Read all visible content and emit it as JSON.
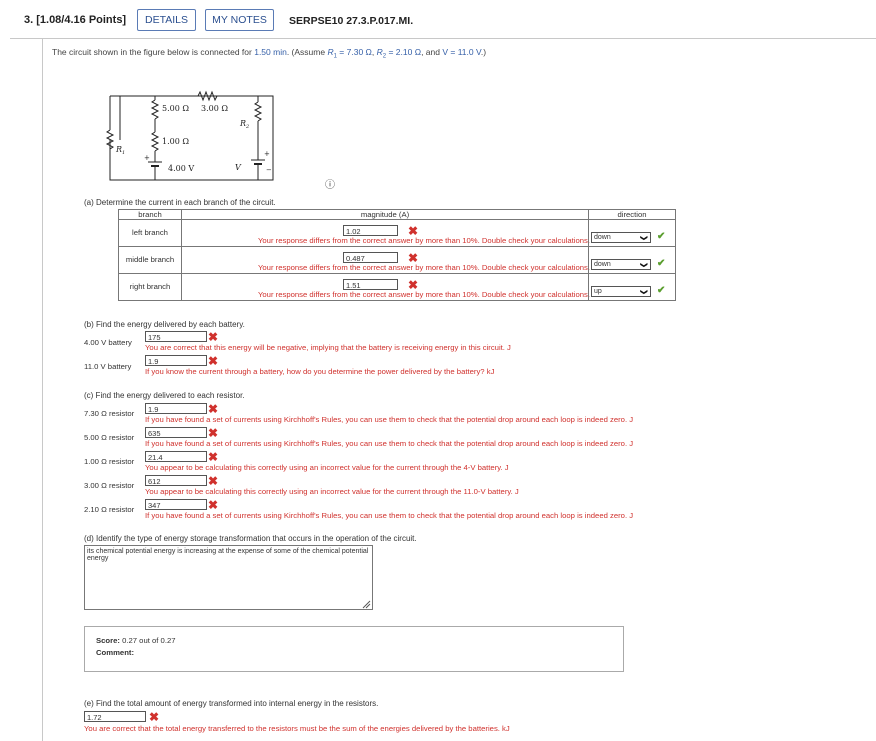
{
  "header": {
    "question_number": "3.  [1.08/4.16 Points]",
    "details_label": "DETAILS",
    "my_notes_label": "MY NOTES",
    "problem_id": "SERPSE10 27.3.P.017.MI."
  },
  "prompt": {
    "text_a": "The circuit shown in the figure below is connected for ",
    "time": "1.50 min",
    "text_b": ". (Assume ",
    "r1_sym": "R",
    "r1_sub": "1",
    "r1_val": " = 7.30 Ω",
    "sep1": ", ",
    "r2_sym": "R",
    "r2_sub": "2",
    "r2_val": " = 2.10 Ω",
    "sep2": ", and ",
    "v_val": "V = 11.0 V",
    "text_c": ".)"
  },
  "figure": {
    "label_5ohm": "5.00 Ω",
    "label_3ohm": "3.00 Ω",
    "label_1ohm": "1.00 Ω",
    "label_4v": "4.00 V",
    "label_r1": "R",
    "label_r1_sub": "1",
    "label_r2": "R",
    "label_r2_sub": "2",
    "label_v": "V",
    "plus1": "+",
    "plus2": "+",
    "minus2": "−"
  },
  "part_a": {
    "question": "(a) Determine the current in each branch of the circuit.",
    "col_branch": "branch",
    "col_magnitude": "magnitude (A)",
    "col_direction": "direction",
    "rows": [
      {
        "branch": "left branch",
        "value": "1.02",
        "feedback": "Your response differs from the correct answer by more than 10%. Double check your calculations.",
        "direction": "down"
      },
      {
        "branch": "middle branch",
        "value": "0.487",
        "feedback": "Your response differs from the correct answer by more than 10%. Double check your calculations.",
        "direction": "down"
      },
      {
        "branch": "right branch",
        "value": "1.51",
        "feedback": "Your response differs from the correct answer by more than 10%. Double check your calculations.",
        "direction": "up"
      }
    ]
  },
  "part_b": {
    "question": "(b) Find the energy delivered by each battery.",
    "rows": [
      {
        "label": "4.00 V battery",
        "value": "175",
        "feedback": "You are correct that this energy will be negative, implying that the battery is receiving energy in this circuit. J"
      },
      {
        "label": "11.0 V battery",
        "value": "1.9",
        "feedback": "If you know the current through a battery, how do you determine the power delivered by the battery? kJ"
      }
    ]
  },
  "part_c": {
    "question": "(c) Find the energy delivered to each resistor.",
    "rows": [
      {
        "label": "7.30 Ω resistor",
        "value": "1.9",
        "feedback": "If you have found a set of currents using Kirchhoff's Rules, you can use them to check that the potential drop around each loop is indeed zero. J"
      },
      {
        "label": "5.00 Ω resistor",
        "value": "635",
        "feedback": "If you have found a set of currents using Kirchhoff's Rules, you can use them to check that the potential drop around each loop is indeed zero. J"
      },
      {
        "label": "1.00 Ω resistor",
        "value": "21.4",
        "feedback": "You appear to be calculating this correctly using an incorrect value for the current through the 4-V battery. J"
      },
      {
        "label": "3.00 Ω resistor",
        "value": "612",
        "feedback": "You appear to be calculating this correctly using an incorrect value for the current through the 11.0-V battery. J"
      },
      {
        "label": "2.10 Ω resistor",
        "value": "347",
        "feedback": "If you have found a set of currents using Kirchhoff's Rules, you can use them to check that the potential drop around each loop is indeed zero. J"
      }
    ]
  },
  "part_d": {
    "question": "(d) Identify the type of energy storage transformation that occurs in the operation of the circuit.",
    "answer": "its chemical potential energy is increasing at the expense of some of the chemical potential energy"
  },
  "score": {
    "label": "Score:",
    "value": "0.27 out of 0.27",
    "comment_label": "Comment:"
  },
  "part_e": {
    "question": "(e) Find the total amount of energy transformed into internal energy in the resistors.",
    "value": "1.72",
    "feedback": "You are correct that the total energy transferred to the resistors must be the sum of the energies delivered by the batteries. kJ"
  },
  "icons": {
    "wrong": "✖",
    "right": "✔",
    "chevron": "❯",
    "info": "ⓘ"
  }
}
